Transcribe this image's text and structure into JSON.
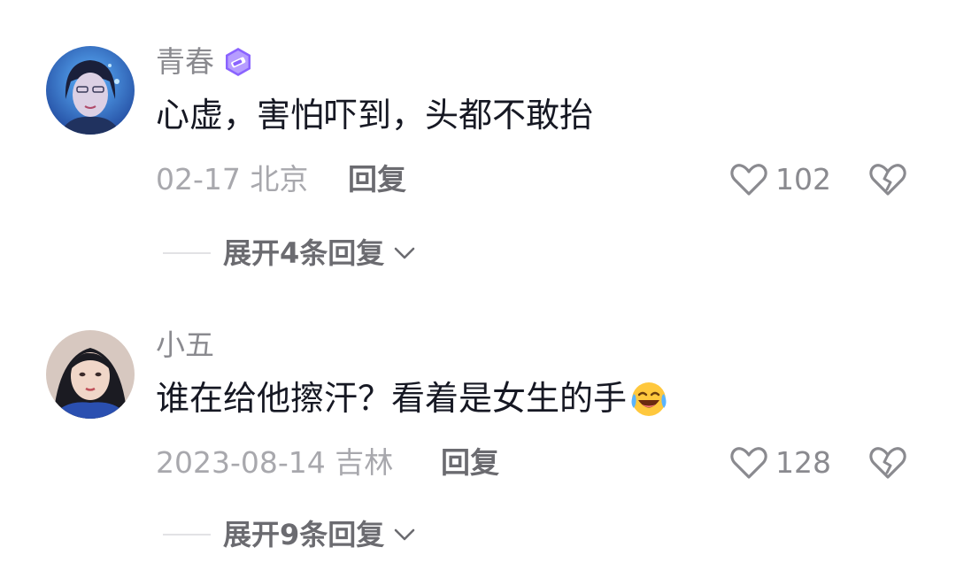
{
  "comments": [
    {
      "username": "青春",
      "badge_icon": "pencil-badge-icon",
      "text": "心虚，害怕吓到，头都不敢抬",
      "meta": "02-17 北京",
      "reply_label": "回复",
      "like_count": "102",
      "expand_label": "展开4条回复"
    },
    {
      "username": "小五",
      "text": "谁在给他擦汗？看着是女生的手",
      "emoji": "laughing-crying-emoji",
      "meta": "2023-08-14 吉林",
      "reply_label": "回复",
      "like_count": "128",
      "expand_label": "展开9条回复"
    }
  ],
  "colors": {
    "text_primary": "#161823",
    "text_secondary": "#8a8a8f",
    "text_meta": "#a8a8ad",
    "badge_purple": "#8a63ff"
  }
}
